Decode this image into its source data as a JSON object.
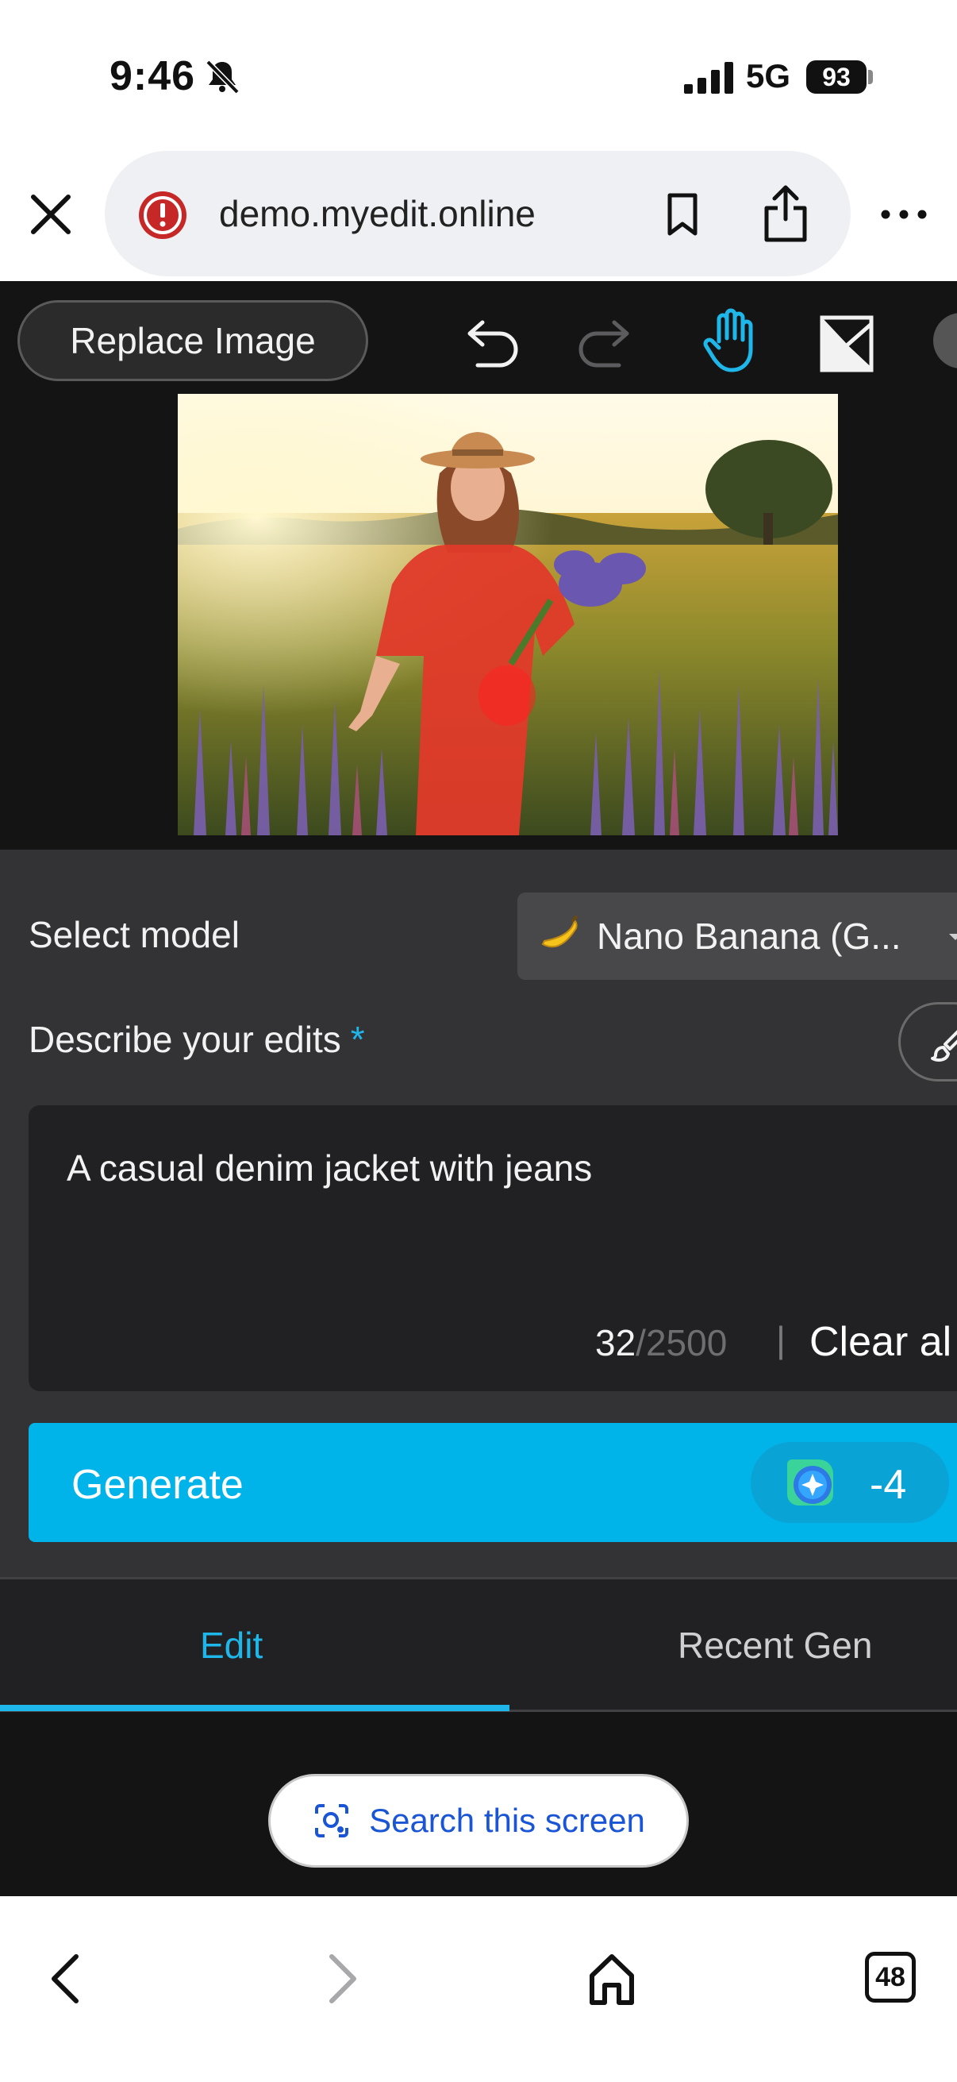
{
  "status_bar": {
    "time": "9:46",
    "network": "5G",
    "battery": "93"
  },
  "browser": {
    "url": "demo.myedit.online",
    "tab_count": "48"
  },
  "toolbar": {
    "replace_label": "Replace Image"
  },
  "settings": {
    "model_label": "Select model",
    "model_value": "Nano Banana (G...",
    "describe_label": "Describe your edits",
    "required_mark": "*",
    "prompt": "A casual denim jacket with jeans",
    "char_count": "32",
    "char_max": "/2500",
    "separator": "|",
    "clear_label": "Clear al",
    "generate_label": "Generate",
    "credit_cost": "-4"
  },
  "tabs": [
    {
      "label": "Edit",
      "active": true
    },
    {
      "label": "Recent Gen",
      "active": false
    }
  ],
  "lens": {
    "label": "Search this screen"
  },
  "colors": {
    "accent": "#00b4ea",
    "panel": "#333335",
    "canvas": "#141414",
    "mask": "#ff2020"
  }
}
